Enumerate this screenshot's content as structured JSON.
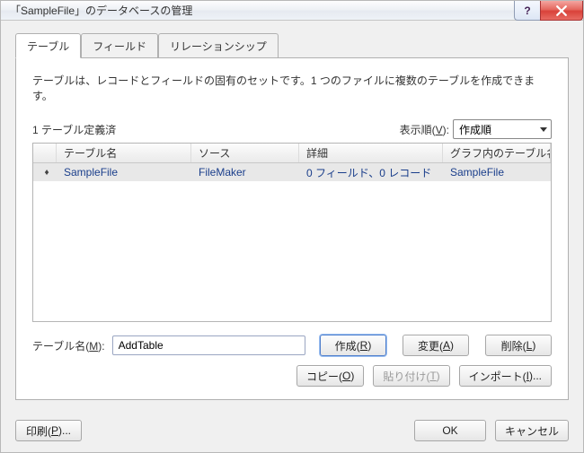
{
  "title": "「SampleFile」のデータベースの管理",
  "tabs": {
    "table": "テーブル",
    "field": "フィールド",
    "relation": "リレーションシップ"
  },
  "description": "テーブルは、レコードとフィールドの固有のセットです。1 つのファイルに複数のテーブルを作成できます。",
  "count_label": "1 テーブル定義済",
  "sort_label_pre": "表示順(",
  "sort_label_u": "V",
  "sort_label_post": "):",
  "sort_value": "作成順",
  "columns": {
    "name": "テーブル名",
    "source": "ソース",
    "detail": "詳細",
    "graph": "グラフ内のテーブル名"
  },
  "rows": [
    {
      "name": "SampleFile",
      "source": "FileMaker",
      "detail": "0 フィールド、0 レコード",
      "graph": "SampleFile"
    }
  ],
  "form": {
    "label_pre": "テーブル名(",
    "label_u": "M",
    "label_post": "):",
    "value": "AddTable"
  },
  "buttons": {
    "create_pre": "作成(",
    "create_u": "R",
    "create_post": ")",
    "modify_pre": "変更(",
    "modify_u": "A",
    "modify_post": ")",
    "delete_pre": "削除(",
    "delete_u": "L",
    "delete_post": ")",
    "copy_pre": "コピー(",
    "copy_u": "O",
    "copy_post": ")",
    "paste_pre": "貼り付け(",
    "paste_u": "T",
    "paste_post": ")",
    "import_pre": "インポート(",
    "import_u": "I",
    "import_post": ")...",
    "print_pre": "印刷(",
    "print_u": "P",
    "print_post": ")...",
    "ok": "OK",
    "cancel": "キャンセル"
  }
}
